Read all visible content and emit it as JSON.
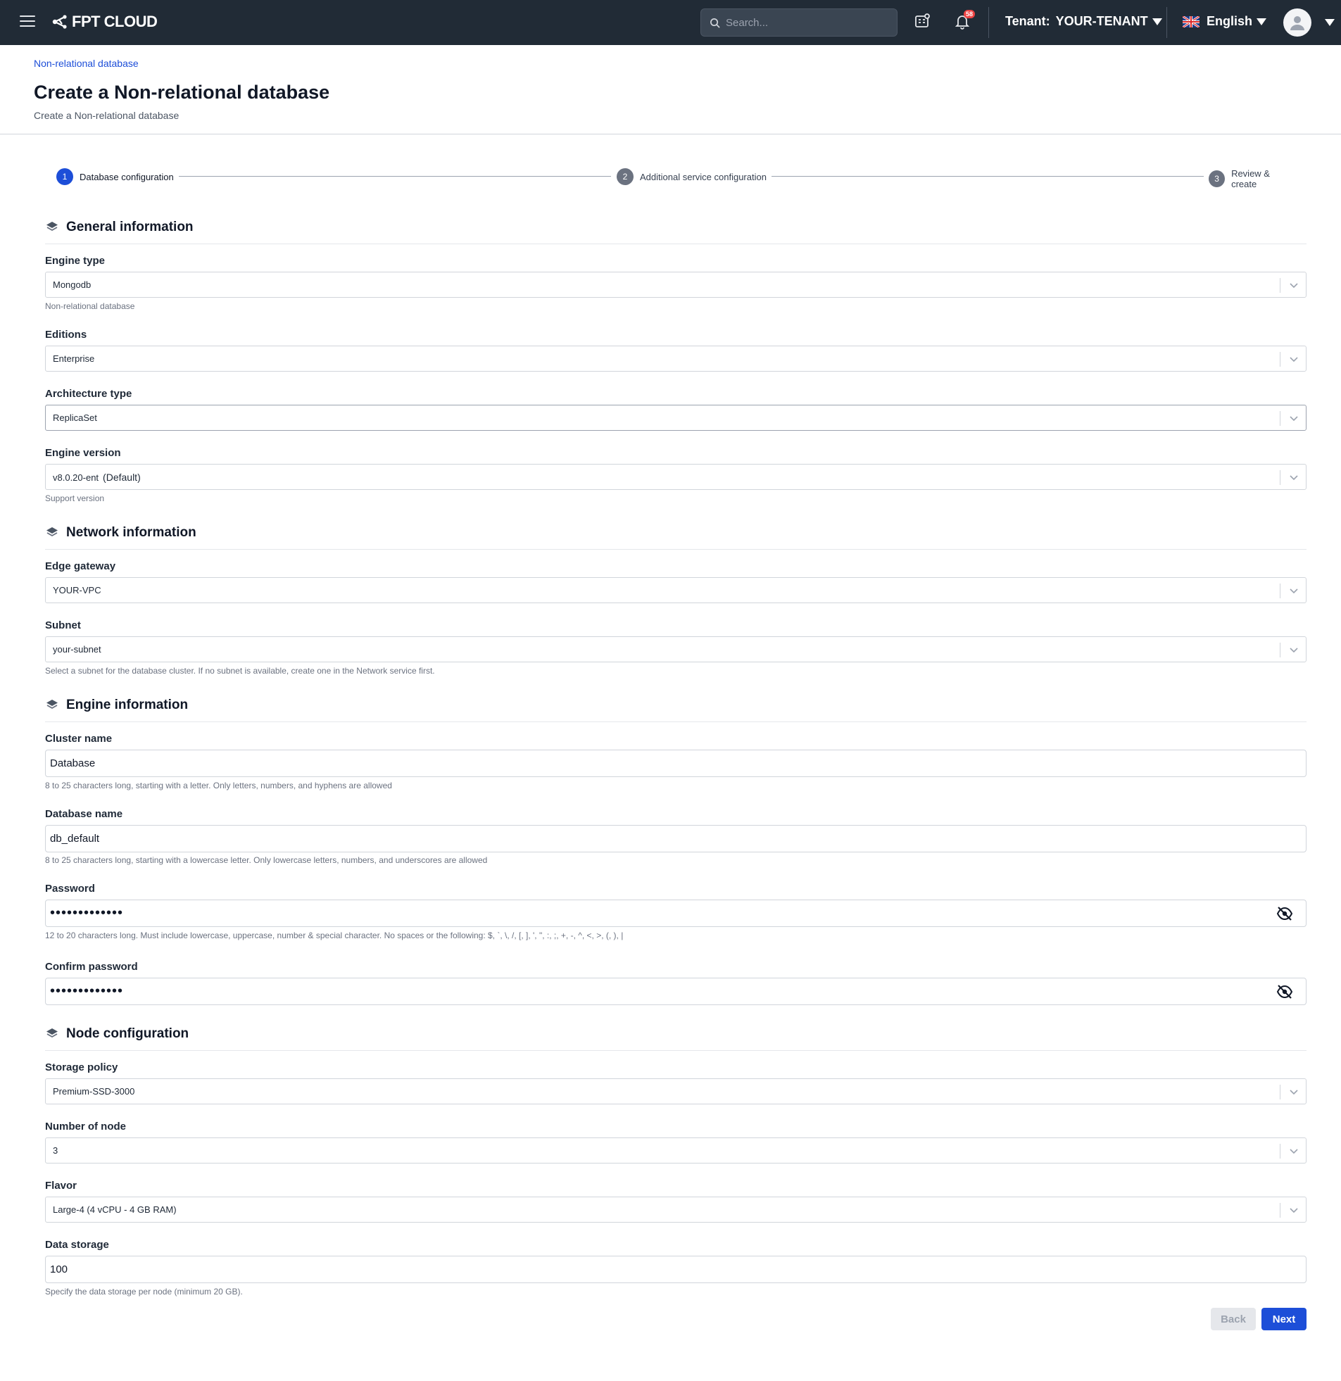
{
  "topbar": {
    "brand": "FPT CLOUD",
    "search_placeholder": "Search...",
    "notification_count": "58",
    "tenant_label": "Tenant:",
    "tenant_value": "YOUR-TENANT",
    "language": "English"
  },
  "header": {
    "breadcrumb": "Non-relational database",
    "title": "Create a Non-relational database",
    "subtitle": "Create a Non-relational database"
  },
  "stepper": {
    "steps": [
      {
        "number": "1",
        "label": "Database configuration",
        "state": "active"
      },
      {
        "number": "2",
        "label": "Additional service configuration",
        "state": "inactive"
      },
      {
        "number": "3",
        "label": "Review & create",
        "state": "inactive"
      }
    ]
  },
  "general": {
    "title": "General information",
    "engine_type": {
      "label": "Engine type",
      "value": "Mongodb",
      "helper": "Non-relational database"
    },
    "editions": {
      "label": "Editions",
      "value": "Enterprise"
    },
    "architecture": {
      "label": "Architecture type",
      "value": "ReplicaSet"
    },
    "engine_version": {
      "label": "Engine version",
      "value": "v8.0.20-ent",
      "extra": "(Default)",
      "helper": "Support version"
    }
  },
  "network": {
    "title": "Network information",
    "edge_gateway": {
      "label": "Edge gateway",
      "value": "YOUR-VPC"
    },
    "subnet": {
      "label": "Subnet",
      "value": "your-subnet",
      "helper": "Select a subnet for the database cluster. If no subnet is available, create one in the Network service first."
    }
  },
  "engine": {
    "title": "Engine information",
    "cluster_name": {
      "label": "Cluster name",
      "value": "Database",
      "helper": "8 to 25 characters long, starting with a letter. Only letters, numbers, and hyphens are allowed"
    },
    "database_name": {
      "label": "Database name",
      "value": "db_default",
      "helper": "8 to 25 characters long, starting with a lowercase letter. Only lowercase letters, numbers, and underscores are allowed"
    },
    "password": {
      "label": "Password",
      "value": "•••••••••••••",
      "helper": "12 to 20 characters long. Must include lowercase, uppercase, number & special character. No spaces or the following: $, `, \\, /, [, ], ', \", :, ;, +, -, ^, <, >, (, ), |"
    },
    "confirm_password": {
      "label": "Confirm password",
      "value": "•••••••••••••"
    }
  },
  "node": {
    "title": "Node configuration",
    "storage_policy": {
      "label": "Storage policy",
      "value": "Premium-SSD-3000"
    },
    "node_count": {
      "label": "Number of node",
      "value": "3"
    },
    "flavor": {
      "label": "Flavor",
      "value": "Large-4 (4 vCPU - 4 GB RAM)"
    },
    "data_storage": {
      "label": "Data storage",
      "value": "100",
      "helper": "Specify the data storage per node (minimum 20 GB)."
    }
  },
  "actions": {
    "back": "Back",
    "next": "Next"
  },
  "colors": {
    "topbar": "#212b36",
    "primary": "#1d4ed8",
    "badge": "#ef4444"
  }
}
